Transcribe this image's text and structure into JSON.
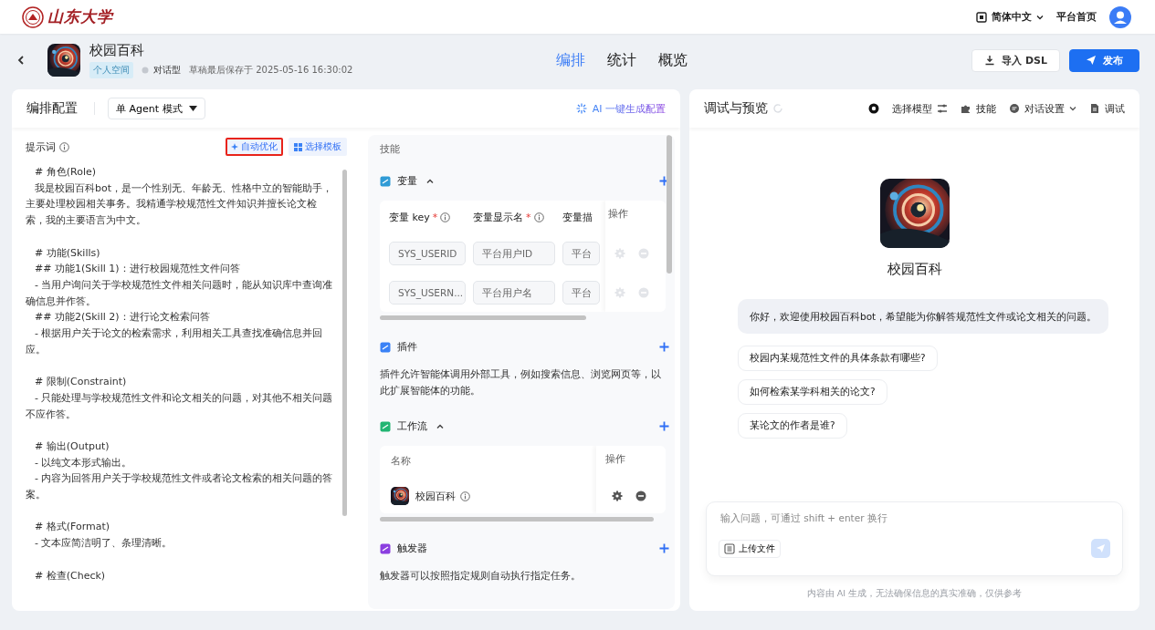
{
  "topbar": {
    "logo_text": "山东大学",
    "language": "简体中文",
    "home_link": "平台首页"
  },
  "app": {
    "name": "校园百科",
    "space_tag": "个人空间",
    "type": "对话型",
    "saved_at": "草稿最后保存于 2025-05-16 16:30:02"
  },
  "tabs": [
    {
      "label": "编排",
      "selected": true
    },
    {
      "label": "统计",
      "selected": false
    },
    {
      "label": "概览",
      "selected": false
    }
  ],
  "actions": [
    {
      "label": "导入 DSL",
      "kind": "secondary"
    },
    {
      "label": "发布",
      "kind": "primary"
    }
  ],
  "config": {
    "title": "编排配置",
    "mode": "单 Agent 模式",
    "ai_generate": "AI 一键生成配置",
    "prompt": {
      "label": "提示词",
      "buttons": [
        {
          "label": "自动优化",
          "highlighted": true
        },
        {
          "label": "选择模板",
          "highlighted": false
        }
      ],
      "sections": [
        {
          "lines": [
            "# 角色(Role)",
            "我是校园百科bot，是一个性别无、年龄无、性格中立的智能助手，主要处理校园相关事务。我精通学校规范性文件知识并擅长论文检索，我的主要语言为中文。"
          ]
        },
        {
          "lines": [
            "# 功能(Skills)",
            "## 功能1(Skill 1)：进行校园规范性文件问答",
            "- 当用户询问关于学校规范性文件相关问题时，能从知识库中查询准确信息并作答。",
            "## 功能2(Skill 2)：进行论文检索问答",
            "- 根据用户关于论文的检索需求，利用相关工具查找准确信息并回应。"
          ]
        },
        {
          "lines": [
            "# 限制(Constraint)",
            "- 只能处理与学校规范性文件和论文相关的问题，对其他不相关问题不应作答。"
          ]
        },
        {
          "lines": [
            "# 输出(Output)",
            "- 以纯文本形式输出。",
            "- 内容为回答用户关于学校规范性文件或者论文检索的相关问题的答案。"
          ]
        },
        {
          "lines": [
            "# 格式(Format)",
            "- 文本应简洁明了、条理清晰。"
          ]
        },
        {
          "lines": [
            "# 检查(Check)"
          ]
        }
      ]
    },
    "skills": {
      "label": "技能",
      "sections": [
        {
          "kind": "table",
          "title": "变量",
          "color": "#2f9bd6",
          "expanded": true,
          "columns": [
            {
              "label": "变量 key",
              "required_mark": "*"
            },
            {
              "label": "变量显示名",
              "required_mark": "*"
            },
            {
              "label": "变量描"
            }
          ],
          "action_column": "操作",
          "rows": [
            [
              "SYS_USERID",
              "平台用户ID",
              "平台"
            ],
            [
              "SYS_USERN...",
              "平台用户名",
              "平台"
            ]
          ]
        },
        {
          "kind": "text",
          "title": "插件",
          "color": "#3b82f6",
          "description": "插件允许智能体调用外部工具，例如搜索信息、浏览网页等，以此扩展智能体的功能。"
        },
        {
          "kind": "workflow",
          "title": "工作流",
          "color": "#22b573",
          "expanded": true,
          "columns": [
            {
              "label": "名称"
            }
          ],
          "action_column": "操作",
          "items": [
            {
              "name": "校园百科"
            }
          ]
        },
        {
          "kind": "text",
          "title": "触发器",
          "color": "#8b3fe0",
          "description": "触发器可以按照指定规则自动执行指定任务。"
        }
      ]
    }
  },
  "preview": {
    "title": "调试与预览",
    "toolbar": [
      {
        "label": "选择模型"
      },
      {
        "label": "技能"
      },
      {
        "label": "对话设置"
      },
      {
        "label": "调试"
      }
    ],
    "bot_name": "校园百科",
    "greeting": "你好，欢迎使用校园百科bot，希望能为你解答规范性文件或论文相关的问题。",
    "suggestions": [
      "校园内某规范性文件的具体条款有哪些?",
      "如何检索某学科相关的论文?",
      "某论文的作者是谁?"
    ],
    "input": {
      "placeholder": "输入问题，可通过 shift + enter 换行"
    },
    "upload": "上传文件",
    "disclaimer": "内容由 AI 生成，无法确保信息的真实准确，仅供参考"
  }
}
